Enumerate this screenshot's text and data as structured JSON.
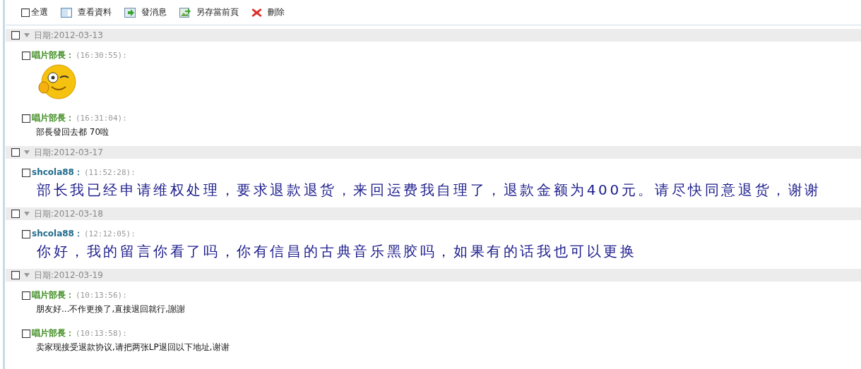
{
  "toolbar": [
    {
      "kind": "checkbox",
      "label": "全選",
      "checked": false
    },
    {
      "kind": "button",
      "label": "查看資料"
    },
    {
      "kind": "button",
      "label": "發消息"
    },
    {
      "kind": "button",
      "label": "另存當前頁"
    },
    {
      "kind": "button",
      "label": "刪除"
    }
  ],
  "groups": [
    {
      "date": "日期:2012-03-13",
      "checked": false,
      "expanded": true,
      "messages": [
        {
          "sender": "唱片部長：",
          "color": "#3c8c1e",
          "time": "(16:30:55):",
          "checked": false,
          "kind": "emoticon"
        },
        {
          "sender": "唱片部長：",
          "color": "#3c8c1e",
          "time": "(16:31:04):",
          "checked": false,
          "kind": "text",
          "text": "部長發回去都 70啦"
        }
      ]
    },
    {
      "date": "日期:2012-03-17",
      "checked": false,
      "expanded": true,
      "messages": [
        {
          "sender": "shcola88：",
          "color": "#236c8c",
          "time": "(11:52:28):",
          "checked": false,
          "kind": "large",
          "text": "部长我已经申请维权处理，要求退款退货，来回运费我自理了，退款金额为400元。请尽快同意退货，谢谢"
        }
      ]
    },
    {
      "date": "日期:2012-03-18",
      "checked": false,
      "expanded": true,
      "messages": [
        {
          "sender": "shcola88：",
          "color": "#236c8c",
          "time": "(12:12:05):",
          "checked": false,
          "kind": "large",
          "text": "你好，我的留言你看了吗，你有信昌的古典音乐黑胶吗，如果有的话我也可以更换"
        }
      ]
    },
    {
      "date": "日期:2012-03-19",
      "checked": false,
      "expanded": true,
      "messages": [
        {
          "sender": "唱片部長：",
          "color": "#3c8c1e",
          "time": "(10:13:56):",
          "checked": false,
          "kind": "text",
          "text": "朋友好...不作更換了,直接退回就行,謝謝"
        },
        {
          "sender": "唱片部長：",
          "color": "#3c8c1e",
          "time": "(10:13:58):",
          "checked": false,
          "kind": "text",
          "text": "卖家现接受退款协议,请把两张LP退回以下地址,谢谢"
        }
      ]
    }
  ]
}
